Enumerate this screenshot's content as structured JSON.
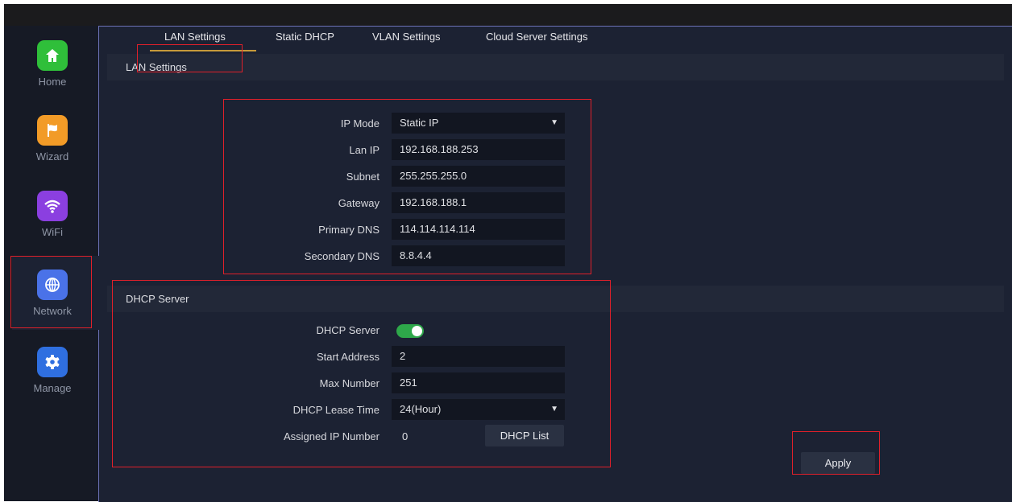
{
  "nav": {
    "items": [
      {
        "label": "Home",
        "icon": "home-icon",
        "color": "#2fbf3a"
      },
      {
        "label": "Wizard",
        "icon": "flag-icon",
        "color": "#f29b27"
      },
      {
        "label": "WiFi",
        "icon": "wifi-icon",
        "color": "#8b3fe0"
      },
      {
        "label": "Network",
        "icon": "globe-icon",
        "color": "#4a72e8"
      },
      {
        "label": "Manage",
        "icon": "gear-icon",
        "color": "#2f6fe0"
      }
    ],
    "active": "Network"
  },
  "tabs": [
    {
      "label": "LAN Settings",
      "active": true
    },
    {
      "label": "Static DHCP",
      "active": false
    },
    {
      "label": "VLAN Settings",
      "active": false
    },
    {
      "label": "Cloud Server Settings",
      "active": false
    }
  ],
  "lan": {
    "section_title": "LAN Settings",
    "ip_mode_label": "IP Mode",
    "ip_mode_value": "Static IP",
    "lan_ip_label": "Lan IP",
    "lan_ip_value": "192.168.188.253",
    "subnet_label": "Subnet",
    "subnet_value": "255.255.255.0",
    "gateway_label": "Gateway",
    "gateway_value": "192.168.188.1",
    "primary_dns_label": "Primary DNS",
    "primary_dns_value": "114.114.114.114",
    "secondary_dns_label": "Secondary DNS",
    "secondary_dns_value": "8.8.4.4"
  },
  "dhcp": {
    "section_title": "DHCP Server",
    "server_label": "DHCP Server",
    "server_enabled": true,
    "start_label": "Start Address",
    "start_value": "2",
    "max_label": "Max Number",
    "max_value": "251",
    "lease_label": "DHCP Lease Time",
    "lease_value": "24(Hour)",
    "assigned_label": "Assigned IP Number",
    "assigned_value": "0",
    "list_button": "DHCP List"
  },
  "apply_button": "Apply",
  "colors": {
    "accent_underline": "#c79a3a",
    "toggle_on": "#2ea84a",
    "highlight": "#e0202a"
  }
}
